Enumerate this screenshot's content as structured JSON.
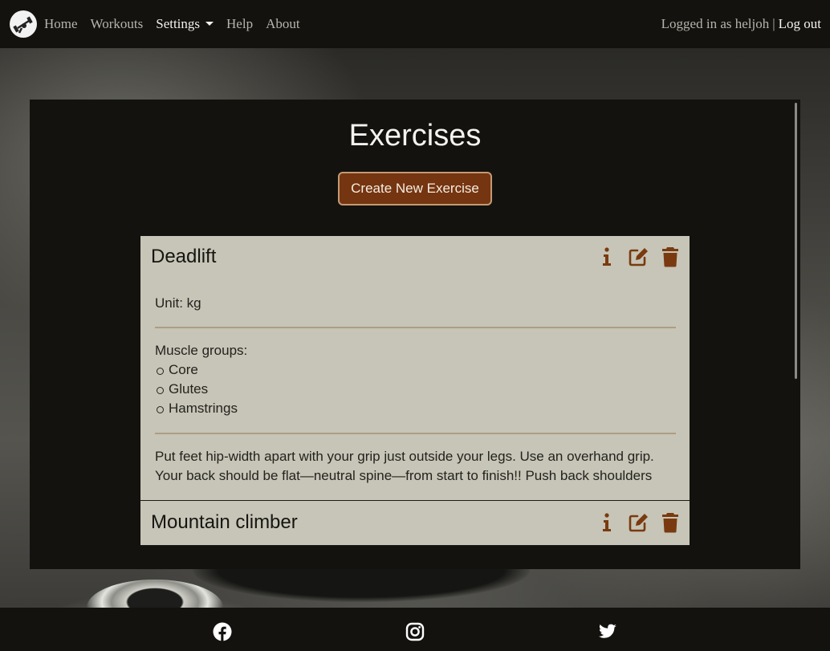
{
  "nav": {
    "links": [
      "Home",
      "Workouts",
      "Settings",
      "Help",
      "About"
    ],
    "logged_in_text": "Logged in as heljoh",
    "separator": "|",
    "logout_label": "Log out"
  },
  "main": {
    "title": "Exercises",
    "create_button_label": "Create New Exercise",
    "exercises": [
      {
        "name": "Deadlift",
        "unit_text": "Unit: kg",
        "muscle_groups_label": "Muscle groups:",
        "muscle_groups": [
          "Core",
          "Glutes",
          "Hamstrings"
        ],
        "description": "Put feet hip-width apart with your grip just outside your legs. Use an overhand grip. Your back should be flat—neutral spine—from start to finish!! Push back shoulders"
      },
      {
        "name": "Mountain climber"
      }
    ]
  },
  "colors": {
    "accent": "#743510",
    "icon": "#7a3a10",
    "card_background": "#c6c5b7",
    "panel_background": "#13120f"
  },
  "icons": {
    "actions": [
      "info-icon",
      "edit-icon",
      "trash-icon"
    ],
    "footer": [
      "facebook-icon",
      "instagram-icon",
      "twitter-icon"
    ]
  }
}
